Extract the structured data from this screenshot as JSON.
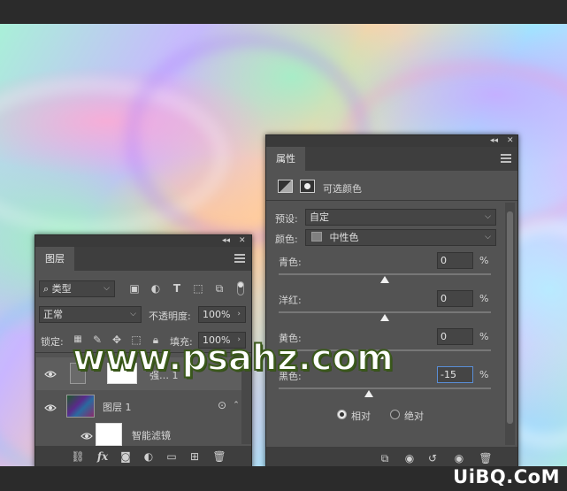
{
  "layers_panel": {
    "tab": "图层",
    "filter_kind": "类型",
    "blend_mode": "正常",
    "opacity_label": "不透明度:",
    "opacity_value": "100%",
    "lock_label": "锁定:",
    "fill_label": "填充:",
    "fill_value": "100%",
    "layers": [
      {
        "name": "强…  1"
      },
      {
        "name": "图层 1"
      },
      {
        "name": "智能滤镜"
      }
    ]
  },
  "properties_panel": {
    "tab": "属性",
    "adjustment_title": "可选颜色",
    "preset_label": "预设:",
    "preset_value": "自定",
    "colors_label": "颜色:",
    "colors_value": "中性色",
    "sliders": [
      {
        "label": "青色:",
        "value": "0",
        "unit": "%",
        "level": 0
      },
      {
        "label": "洋红:",
        "value": "0",
        "unit": "%",
        "level": 0
      },
      {
        "label": "黄色:",
        "value": "0",
        "unit": "%",
        "level": 0
      },
      {
        "label": "黑色:",
        "value": "-15",
        "unit": "%",
        "level": -15
      }
    ],
    "method_relative": "相对",
    "method_absolute": "绝对",
    "method_selected": "relative"
  },
  "watermark": "www.psahz.com",
  "logo": "UiBQ.CoM",
  "colors": {
    "panel_bg": "#535353",
    "panel_dark": "#3e3e3e",
    "input_bg": "#454545"
  }
}
